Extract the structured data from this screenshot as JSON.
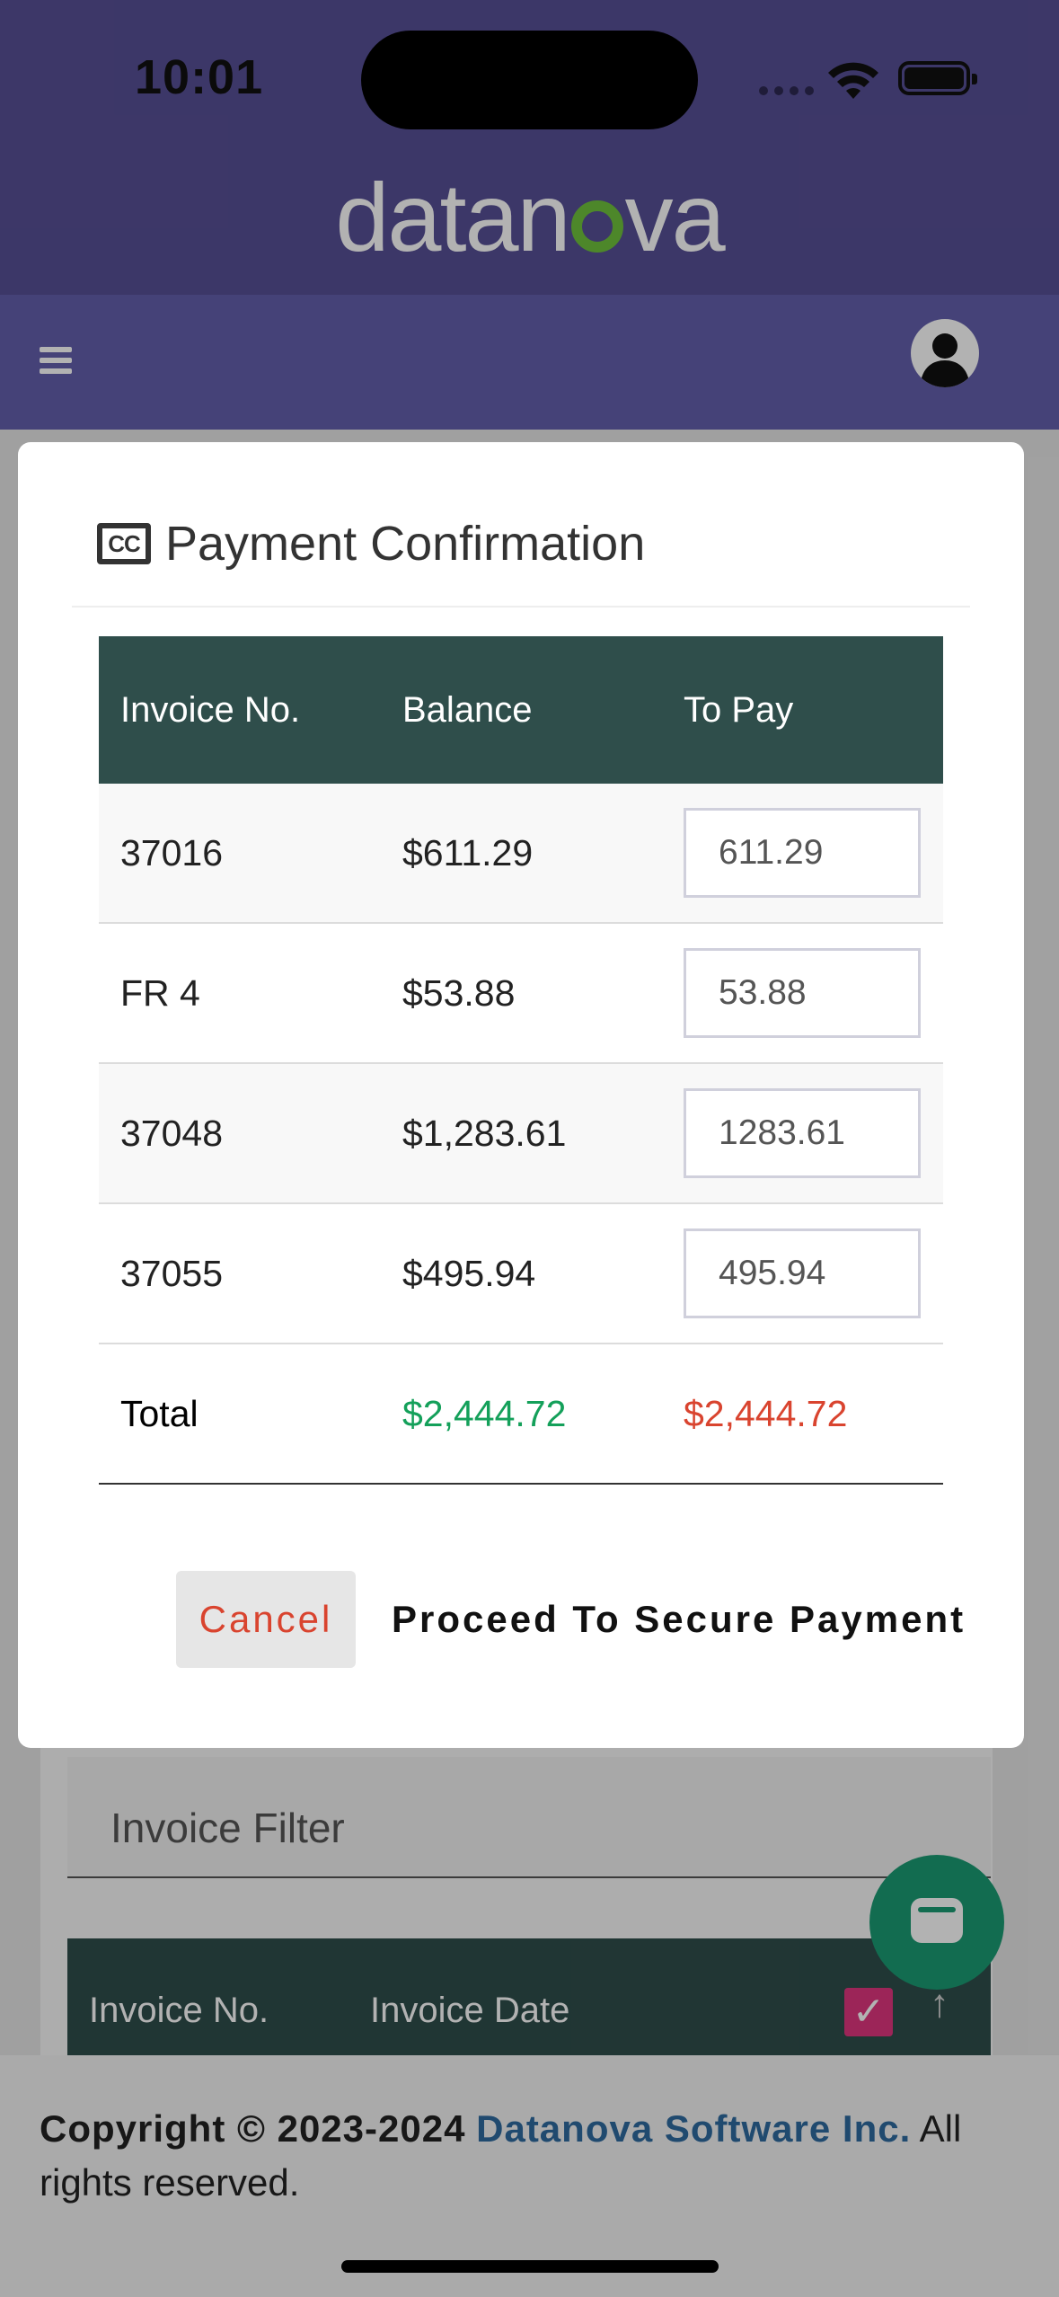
{
  "status_bar": {
    "time": "10:01"
  },
  "header": {
    "brand_pre": "datan",
    "brand_post": "va"
  },
  "background": {
    "filter_placeholder": "Invoice Filter",
    "table_headers": [
      "Invoice No.",
      "Invoice Date"
    ]
  },
  "modal": {
    "icon_text": "CC",
    "title": "Payment Confirmation",
    "columns": [
      "Invoice No.",
      "Balance",
      "To Pay"
    ],
    "rows": [
      {
        "invoice": "37016",
        "balance": "$611.29",
        "to_pay": "611.29"
      },
      {
        "invoice": "FR 4",
        "balance": "$53.88",
        "to_pay": "53.88"
      },
      {
        "invoice": "37048",
        "balance": "$1,283.61",
        "to_pay": "1283.61"
      },
      {
        "invoice": "37055",
        "balance": "$495.94",
        "to_pay": "495.94"
      }
    ],
    "total": {
      "label": "Total",
      "balance": "$2,444.72",
      "to_pay": "$2,444.72"
    },
    "cancel_label": "Cancel",
    "proceed_label": "Proceed To Secure Payment"
  },
  "footer": {
    "copyright": "Copyright © 2023-2024",
    "company": "Datanova Software Inc.",
    "rights": "All rights reserved."
  },
  "colors": {
    "header_bg": "#574f95",
    "navbar_bg": "#645fac",
    "table_head_bg": "#2f4e4b",
    "total_balance": "#14a05a",
    "total_to_pay": "#d9442f",
    "fab_bg": "#1a9b73",
    "logo_accent": "#6fc23d"
  }
}
